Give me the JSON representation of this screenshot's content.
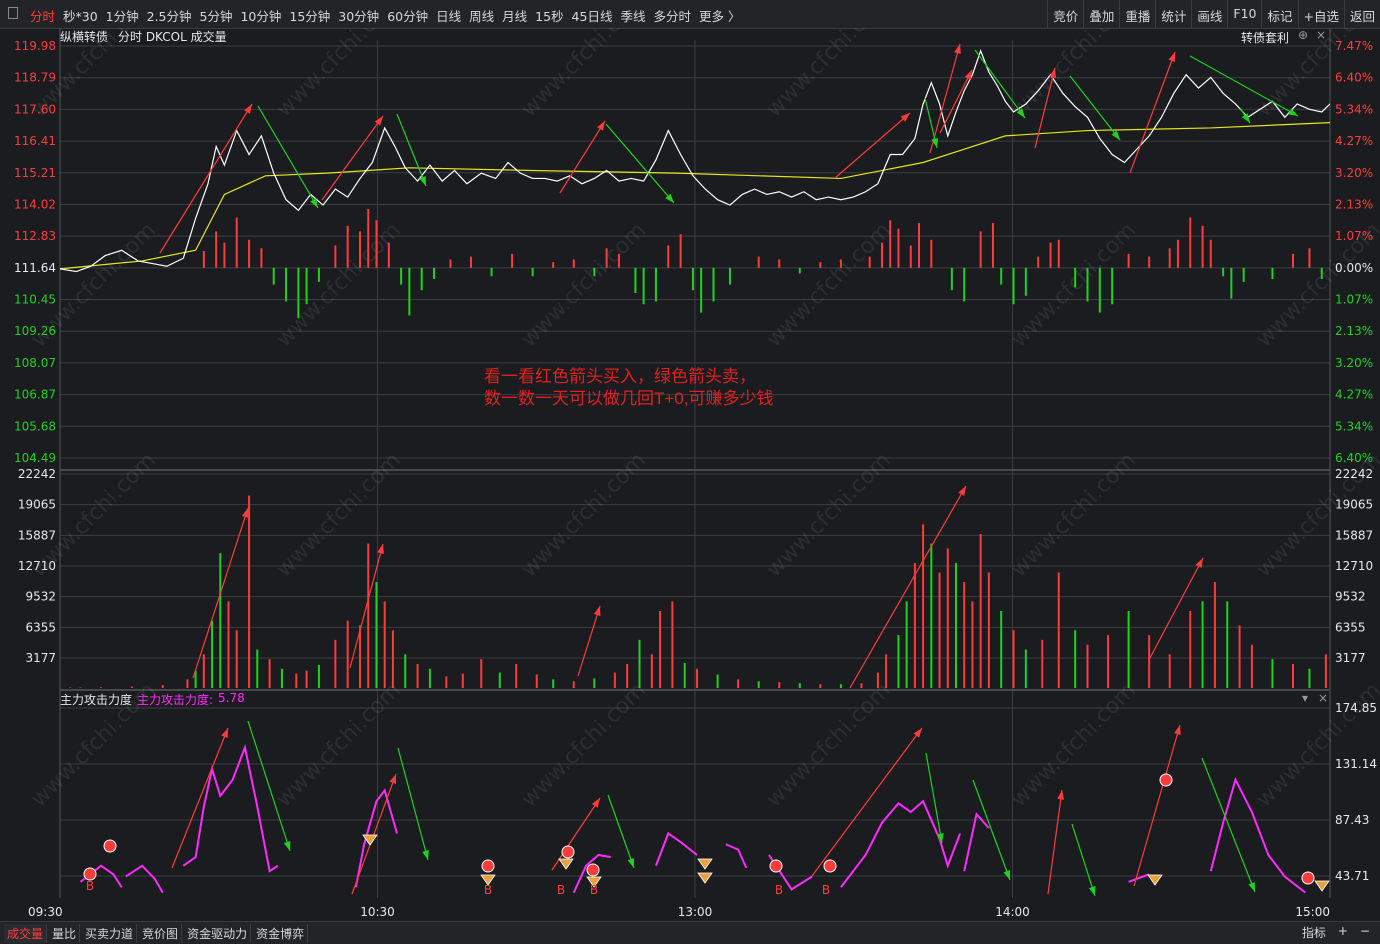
{
  "toolbar": {
    "periods": [
      "分时",
      "秒*30",
      "1分钟",
      "2.5分钟",
      "5分钟",
      "10分钟",
      "15分钟",
      "30分钟",
      "60分钟",
      "日线",
      "周线",
      "月线",
      "15秒",
      "45日线",
      "季线",
      "多分时",
      "更多 〉"
    ],
    "active_period": "分时",
    "tools": [
      "竞价",
      "叠加",
      "重播",
      "统计",
      "画线",
      "F10",
      "标记",
      "+自选",
      "返回"
    ]
  },
  "header": {
    "stock_name": "纵横转债",
    "mode": "分时 DKCOL 成交量",
    "right_label": "转债套利"
  },
  "indicator": {
    "name": "主力攻击力度",
    "label": "主力攻击力度:",
    "value": "5.78"
  },
  "annotation": {
    "line1": "看一看红色箭头买入，绿色箭头卖，",
    "line2": "数一数一天可以做几回T+0,可赚多少钱"
  },
  "watermark": "www.cfchi.com",
  "colors": {
    "red": "#ff3b3b",
    "green": "#1ed21e",
    "price_line": "#ffffff",
    "avg_line": "#e6e61e",
    "indicator_line": "#ff2bff",
    "annotation": "#e0201f"
  },
  "chart_data": {
    "type": "line",
    "time_axis": [
      "09:30",
      "10:30",
      "13:00",
      "14:00",
      "15:00"
    ],
    "price_axis": {
      "left_ticks": [
        "119.98",
        "118.79",
        "117.60",
        "116.41",
        "115.21",
        "114.02",
        "112.83",
        "111.64",
        "110.45",
        "109.26",
        "108.07",
        "106.87",
        "105.68",
        "104.49"
      ],
      "right_ticks": [
        "7.47%",
        "6.40%",
        "5.34%",
        "4.27%",
        "3.20%",
        "2.13%",
        "1.07%",
        "0.00%",
        "1.07%",
        "2.13%",
        "3.20%",
        "4.27%",
        "5.34%",
        "6.40%"
      ],
      "base": 111.64,
      "ylim": [
        104.49,
        119.98
      ]
    },
    "volume_axis": {
      "ticks": [
        "22242",
        "19065",
        "15887",
        "12710",
        "9532",
        "6355",
        "3177"
      ],
      "ylim": [
        0,
        22242
      ]
    },
    "indicator_axis": {
      "ticks": [
        "174.85",
        "131.14",
        "87.43",
        "43.71"
      ],
      "ylim": [
        0,
        174.85
      ]
    },
    "price_series": [
      [
        0,
        111.6
      ],
      [
        8,
        111.5
      ],
      [
        15,
        111.7
      ],
      [
        22,
        112.1
      ],
      [
        30,
        112.3
      ],
      [
        38,
        111.9
      ],
      [
        45,
        111.8
      ],
      [
        52,
        111.7
      ],
      [
        60,
        112.0
      ],
      [
        66,
        113.5
      ],
      [
        72,
        114.8
      ],
      [
        76,
        116.2
      ],
      [
        80,
        115.5
      ],
      [
        86,
        116.8
      ],
      [
        92,
        115.9
      ],
      [
        98,
        116.6
      ],
      [
        104,
        115.2
      ],
      [
        110,
        114.2
      ],
      [
        116,
        113.8
      ],
      [
        122,
        114.4
      ],
      [
        128,
        114.0
      ],
      [
        134,
        114.6
      ],
      [
        140,
        114.3
      ],
      [
        146,
        115.0
      ],
      [
        152,
        115.6
      ],
      [
        158,
        116.9
      ],
      [
        163,
        116.2
      ],
      [
        168,
        115.4
      ],
      [
        174,
        114.9
      ],
      [
        180,
        115.5
      ],
      [
        186,
        114.9
      ],
      [
        192,
        115.3
      ],
      [
        198,
        114.8
      ],
      [
        205,
        115.2
      ],
      [
        212,
        115.0
      ],
      [
        218,
        115.6
      ],
      [
        224,
        115.2
      ],
      [
        230,
        115.0
      ],
      [
        236,
        115.0
      ],
      [
        242,
        114.9
      ],
      [
        248,
        115.1
      ],
      [
        254,
        114.8
      ],
      [
        260,
        115.0
      ],
      [
        266,
        115.3
      ],
      [
        272,
        114.9
      ],
      [
        278,
        115.0
      ],
      [
        284,
        114.9
      ],
      [
        290,
        115.7
      ],
      [
        296,
        116.8
      ],
      [
        302,
        115.9
      ],
      [
        308,
        115.1
      ],
      [
        314,
        114.6
      ],
      [
        320,
        114.2
      ],
      [
        326,
        114.0
      ],
      [
        332,
        114.4
      ],
      [
        338,
        114.6
      ],
      [
        344,
        114.4
      ],
      [
        350,
        114.5
      ],
      [
        356,
        114.3
      ],
      [
        362,
        114.5
      ],
      [
        368,
        114.2
      ],
      [
        374,
        114.3
      ],
      [
        380,
        114.2
      ],
      [
        386,
        114.3
      ],
      [
        392,
        114.5
      ],
      [
        398,
        114.8
      ],
      [
        404,
        115.9
      ],
      [
        410,
        115.9
      ],
      [
        416,
        116.5
      ],
      [
        420,
        117.8
      ],
      [
        424,
        118.6
      ],
      [
        428,
        117.8
      ],
      [
        432,
        116.6
      ],
      [
        436,
        117.5
      ],
      [
        440,
        118.3
      ],
      [
        444,
        118.9
      ],
      [
        448,
        119.8
      ],
      [
        452,
        119.0
      ],
      [
        456,
        118.5
      ],
      [
        460,
        117.9
      ],
      [
        464,
        117.5
      ],
      [
        470,
        117.8
      ],
      [
        476,
        118.3
      ],
      [
        482,
        118.9
      ],
      [
        488,
        118.2
      ],
      [
        494,
        117.7
      ],
      [
        500,
        117.3
      ],
      [
        506,
        116.5
      ],
      [
        512,
        115.9
      ],
      [
        518,
        115.6
      ],
      [
        524,
        116.1
      ],
      [
        530,
        116.6
      ],
      [
        536,
        117.3
      ],
      [
        542,
        118.2
      ],
      [
        548,
        118.9
      ],
      [
        554,
        118.4
      ],
      [
        560,
        118.8
      ],
      [
        566,
        118.2
      ],
      [
        572,
        117.8
      ],
      [
        578,
        117.3
      ],
      [
        584,
        117.6
      ],
      [
        590,
        117.9
      ],
      [
        596,
        117.3
      ],
      [
        602,
        117.8
      ],
      [
        608,
        117.6
      ],
      [
        614,
        117.5
      ],
      [
        618,
        117.8
      ]
    ],
    "avg_series": [
      [
        0,
        111.6
      ],
      [
        40,
        111.9
      ],
      [
        66,
        112.3
      ],
      [
        80,
        114.4
      ],
      [
        100,
        115.1
      ],
      [
        130,
        115.2
      ],
      [
        170,
        115.4
      ],
      [
        230,
        115.3
      ],
      [
        300,
        115.2
      ],
      [
        380,
        115.0
      ],
      [
        420,
        115.6
      ],
      [
        440,
        116.1
      ],
      [
        460,
        116.6
      ],
      [
        500,
        116.8
      ],
      [
        560,
        116.9
      ],
      [
        618,
        117.1
      ]
    ],
    "volume_bars": [
      [
        5,
        60,
        "r"
      ],
      [
        10,
        40,
        "g"
      ],
      [
        20,
        80,
        "r"
      ],
      [
        35,
        150,
        "r"
      ],
      [
        50,
        300,
        "r"
      ],
      [
        62,
        900,
        "r"
      ],
      [
        66,
        1800,
        "g"
      ],
      [
        70,
        3500,
        "r"
      ],
      [
        74,
        7000,
        "g"
      ],
      [
        78,
        14000,
        "g"
      ],
      [
        82,
        9000,
        "r"
      ],
      [
        86,
        6000,
        "r"
      ],
      [
        92,
        20000,
        "r"
      ],
      [
        96,
        4000,
        "g"
      ],
      [
        102,
        3000,
        "r"
      ],
      [
        108,
        2000,
        "g"
      ],
      [
        115,
        1500,
        "r"
      ],
      [
        120,
        1800,
        "r"
      ],
      [
        126,
        2400,
        "g"
      ],
      [
        134,
        5000,
        "r"
      ],
      [
        140,
        7000,
        "r"
      ],
      [
        146,
        6500,
        "r"
      ],
      [
        150,
        15000,
        "r"
      ],
      [
        154,
        11000,
        "g"
      ],
      [
        158,
        9000,
        "r"
      ],
      [
        162,
        6000,
        "r"
      ],
      [
        168,
        3500,
        "g"
      ],
      [
        174,
        2500,
        "r"
      ],
      [
        180,
        2000,
        "g"
      ],
      [
        188,
        1200,
        "r"
      ],
      [
        196,
        1500,
        "r"
      ],
      [
        205,
        3000,
        "r"
      ],
      [
        214,
        1600,
        "g"
      ],
      [
        222,
        2500,
        "r"
      ],
      [
        232,
        1400,
        "r"
      ],
      [
        240,
        900,
        "g"
      ],
      [
        250,
        700,
        "r"
      ],
      [
        260,
        1000,
        "g"
      ],
      [
        270,
        1600,
        "r"
      ],
      [
        276,
        2500,
        "r"
      ],
      [
        282,
        5000,
        "g"
      ],
      [
        288,
        3500,
        "r"
      ],
      [
        292,
        8000,
        "r"
      ],
      [
        298,
        9000,
        "r"
      ],
      [
        304,
        2600,
        "g"
      ],
      [
        310,
        2000,
        "r"
      ],
      [
        320,
        1400,
        "g"
      ],
      [
        330,
        900,
        "r"
      ],
      [
        340,
        700,
        "g"
      ],
      [
        350,
        600,
        "r"
      ],
      [
        360,
        500,
        "g"
      ],
      [
        370,
        400,
        "r"
      ],
      [
        380,
        400,
        "g"
      ],
      [
        390,
        500,
        "r"
      ],
      [
        398,
        1600,
        "r"
      ],
      [
        402,
        3500,
        "r"
      ],
      [
        408,
        5500,
        "g"
      ],
      [
        412,
        9000,
        "g"
      ],
      [
        416,
        13000,
        "r"
      ],
      [
        420,
        17000,
        "r"
      ],
      [
        424,
        15000,
        "g"
      ],
      [
        428,
        12000,
        "r"
      ],
      [
        432,
        14500,
        "r"
      ],
      [
        436,
        13000,
        "g"
      ],
      [
        440,
        11000,
        "r"
      ],
      [
        444,
        9000,
        "r"
      ],
      [
        448,
        16000,
        "r"
      ],
      [
        452,
        12000,
        "r"
      ],
      [
        458,
        8000,
        "g"
      ],
      [
        464,
        6000,
        "r"
      ],
      [
        470,
        4000,
        "g"
      ],
      [
        478,
        5000,
        "r"
      ],
      [
        486,
        12000,
        "r"
      ],
      [
        494,
        6000,
        "g"
      ],
      [
        500,
        4500,
        "r"
      ],
      [
        510,
        5500,
        "r"
      ],
      [
        520,
        8000,
        "g"
      ],
      [
        530,
        5500,
        "r"
      ],
      [
        540,
        3500,
        "r"
      ],
      [
        550,
        8000,
        "r"
      ],
      [
        556,
        9000,
        "g"
      ],
      [
        562,
        11000,
        "r"
      ],
      [
        568,
        9000,
        "g"
      ],
      [
        574,
        6500,
        "r"
      ],
      [
        580,
        4500,
        "r"
      ],
      [
        590,
        3000,
        "g"
      ],
      [
        600,
        2500,
        "r"
      ],
      [
        608,
        2000,
        "g"
      ],
      [
        616,
        3500,
        "r"
      ]
    ],
    "diff_bars": [
      [
        70,
        0.6
      ],
      [
        76,
        1.3
      ],
      [
        80,
        0.9
      ],
      [
        86,
        1.8
      ],
      [
        92,
        1.0
      ],
      [
        98,
        0.7
      ],
      [
        104,
        -0.6
      ],
      [
        110,
        -1.2
      ],
      [
        116,
        -1.8
      ],
      [
        120,
        -1.3
      ],
      [
        126,
        -0.5
      ],
      [
        134,
        0.8
      ],
      [
        140,
        1.5
      ],
      [
        146,
        1.3
      ],
      [
        150,
        2.1
      ],
      [
        154,
        1.7
      ],
      [
        160,
        0.9
      ],
      [
        166,
        -0.6
      ],
      [
        170,
        -1.7
      ],
      [
        176,
        -0.8
      ],
      [
        182,
        -0.4
      ],
      [
        190,
        0.3
      ],
      [
        200,
        0.4
      ],
      [
        210,
        -0.3
      ],
      [
        220,
        0.5
      ],
      [
        230,
        -0.3
      ],
      [
        240,
        0.2
      ],
      [
        250,
        0.3
      ],
      [
        260,
        -0.3
      ],
      [
        266,
        0.7
      ],
      [
        272,
        0.5
      ],
      [
        280,
        -0.9
      ],
      [
        284,
        -1.3
      ],
      [
        290,
        -1.2
      ],
      [
        296,
        0.8
      ],
      [
        302,
        1.2
      ],
      [
        308,
        -0.8
      ],
      [
        312,
        -1.6
      ],
      [
        318,
        -1.2
      ],
      [
        326,
        -0.6
      ],
      [
        340,
        0.4
      ],
      [
        350,
        0.3
      ],
      [
        360,
        -0.2
      ],
      [
        370,
        0.2
      ],
      [
        380,
        0.3
      ],
      [
        394,
        0.4
      ],
      [
        400,
        0.9
      ],
      [
        404,
        1.7
      ],
      [
        408,
        1.4
      ],
      [
        414,
        0.8
      ],
      [
        418,
        1.6
      ],
      [
        424,
        1.0
      ],
      [
        434,
        -0.8
      ],
      [
        440,
        -1.2
      ],
      [
        448,
        1.3
      ],
      [
        454,
        1.6
      ],
      [
        458,
        -0.6
      ],
      [
        464,
        -1.3
      ],
      [
        470,
        -1.0
      ],
      [
        476,
        0.4
      ],
      [
        482,
        0.9
      ],
      [
        486,
        1.0
      ],
      [
        494,
        -0.7
      ],
      [
        500,
        -1.2
      ],
      [
        506,
        -1.6
      ],
      [
        512,
        -1.3
      ],
      [
        520,
        0.5
      ],
      [
        530,
        0.4
      ],
      [
        540,
        0.7
      ],
      [
        544,
        1.0
      ],
      [
        550,
        1.8
      ],
      [
        556,
        1.5
      ],
      [
        560,
        1.0
      ],
      [
        566,
        -0.3
      ],
      [
        570,
        -1.1
      ],
      [
        576,
        -0.5
      ],
      [
        590,
        -0.4
      ],
      [
        600,
        0.5
      ],
      [
        608,
        0.7
      ],
      [
        614,
        -0.4
      ]
    ],
    "indicator_series": [
      [
        [
          10,
          15
        ],
        [
          20,
          30
        ],
        [
          26,
          22
        ],
        [
          30,
          10
        ]
      ],
      [
        [
          32,
          20
        ],
        [
          40,
          30
        ],
        [
          46,
          18
        ],
        [
          50,
          5
        ]
      ],
      [
        [
          60,
          30
        ],
        [
          66,
          38
        ],
        [
          70,
          85
        ],
        [
          74,
          120
        ],
        [
          78,
          95
        ],
        [
          84,
          110
        ],
        [
          90,
          140
        ],
        [
          96,
          85
        ],
        [
          102,
          25
        ],
        [
          106,
          30
        ]
      ],
      [
        [
          144,
          10
        ],
        [
          148,
          50
        ],
        [
          154,
          90
        ],
        [
          158,
          100
        ],
        [
          164,
          60
        ]
      ],
      [
        [
          250,
          5
        ],
        [
          256,
          30
        ],
        [
          262,
          40
        ],
        [
          268,
          38
        ]
      ],
      [
        [
          290,
          30
        ],
        [
          296,
          60
        ],
        [
          302,
          52
        ],
        [
          310,
          40
        ]
      ],
      [
        [
          324,
          50
        ],
        [
          330,
          45
        ],
        [
          334,
          28
        ]
      ],
      [
        [
          345,
          40
        ],
        [
          356,
          8
        ],
        [
          366,
          20
        ]
      ],
      [
        [
          380,
          10
        ],
        [
          392,
          40
        ],
        [
          400,
          70
        ],
        [
          408,
          88
        ],
        [
          414,
          80
        ],
        [
          420,
          90
        ],
        [
          428,
          55
        ],
        [
          432,
          30
        ],
        [
          438,
          60
        ]
      ],
      [
        [
          440,
          25
        ],
        [
          446,
          78
        ],
        [
          452,
          65
        ]
      ],
      [
        [
          520,
          15
        ],
        [
          530,
          22
        ]
      ],
      [
        [
          560,
          25
        ],
        [
          566,
          70
        ],
        [
          572,
          110
        ],
        [
          580,
          80
        ],
        [
          588,
          40
        ],
        [
          596,
          20
        ],
        [
          606,
          5
        ]
      ]
    ]
  }
}
